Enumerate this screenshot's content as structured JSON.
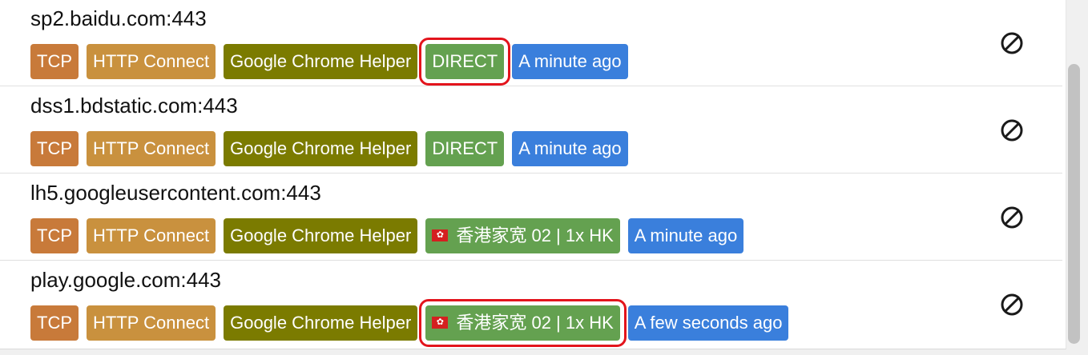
{
  "connections": [
    {
      "host": "sp2.baidu.com:443",
      "network": "TCP",
      "type": "HTTP Connect",
      "process": "Google Chrome Helper",
      "rule": "DIRECT",
      "rule_flag": false,
      "time": "A minute ago"
    },
    {
      "host": "dss1.bdstatic.com:443",
      "network": "TCP",
      "type": "HTTP Connect",
      "process": "Google Chrome Helper",
      "rule": "DIRECT",
      "rule_flag": false,
      "time": "A minute ago"
    },
    {
      "host": "lh5.googleusercontent.com:443",
      "network": "TCP",
      "type": "HTTP Connect",
      "process": "Google Chrome Helper",
      "rule": "香港家宽 02 | 1x HK",
      "rule_flag": true,
      "time": "A minute ago"
    },
    {
      "host": "play.google.com:443",
      "network": "TCP",
      "type": "HTTP Connect",
      "process": "Google Chrome Helper",
      "rule": "香港家宽 02 | 1x HK",
      "rule_flag": true,
      "time": "A few seconds ago"
    }
  ],
  "colors": {
    "tcp": "#c87a3a",
    "http_connect": "#c9913e",
    "process": "#7b7b00",
    "rule": "#64a150",
    "time": "#3a7fdc",
    "highlight_box": "#e3141c"
  },
  "icons": {
    "close_connection": "block-icon",
    "hk_flag": "hk-flag-icon"
  }
}
